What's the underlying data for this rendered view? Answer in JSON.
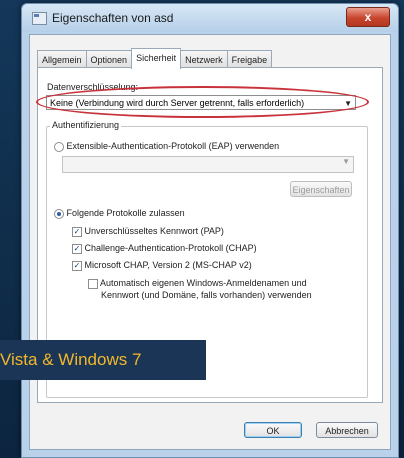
{
  "window": {
    "title": "Eigenschaften von asd",
    "close_label": "x"
  },
  "tabs": [
    {
      "label": "Allgemein",
      "active": false
    },
    {
      "label": "Optionen",
      "active": false
    },
    {
      "label": "Sicherheit",
      "active": true
    },
    {
      "label": "Netzwerk",
      "active": false
    },
    {
      "label": "Freigabe",
      "active": false
    }
  ],
  "security": {
    "encryption_label": "Datenverschlüsselung:",
    "encryption_value": "Keine (Verbindung wird durch Server getrennt, falls erforderlich)",
    "auth_group_label": "Authentifizierung",
    "eap_option": "Extensible-Authentication-Protokoll (EAP) verwenden",
    "eap_select_value": "",
    "properties_button": "Eigenschaften",
    "allow_protocols_option": "Folgende Protokolle zulassen",
    "pap_label": "Unverschlüsseltes Kennwort (PAP)",
    "chap_label": "Challenge-Authentication-Protokoll (CHAP)",
    "mschap_label": "Microsoft CHAP, Version 2 (MS-CHAP v2)",
    "auto_windows_label_1": "Automatisch eigenen Windows-Anmeldenamen und",
    "auto_windows_label_2": "Kennwort (und Domäne, falls vorhanden) verwenden"
  },
  "checkboxes": {
    "pap": true,
    "chap": true,
    "mschap": true,
    "auto_windows": false
  },
  "radios": {
    "eap": false,
    "allow_protocols": true
  },
  "buttons": {
    "ok": "OK",
    "cancel": "Abbrechen"
  },
  "banner": {
    "text": "Vista & Windows 7"
  },
  "colors": {
    "highlight_ellipse": "#c8323a",
    "banner_bg": "#1b3556",
    "banner_text": "#f2b82a"
  }
}
